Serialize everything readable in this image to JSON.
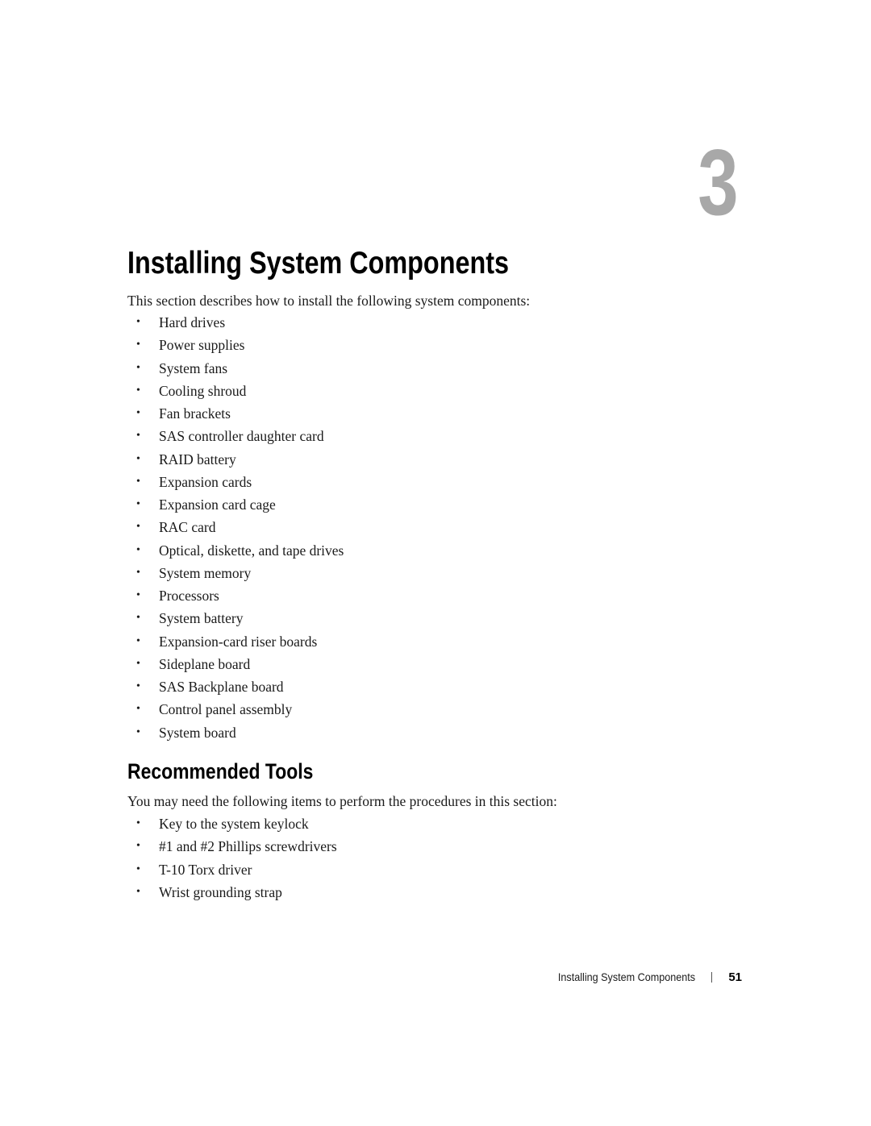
{
  "chapter": {
    "number": "3",
    "title": "Installing System Components"
  },
  "intro": "This section describes how to install the following system components:",
  "components": [
    "Hard drives",
    "Power supplies",
    "System fans",
    "Cooling shroud",
    "Fan brackets",
    "SAS controller daughter card",
    "RAID battery",
    "Expansion cards",
    "Expansion card cage",
    "RAC card",
    "Optical, diskette, and tape drives",
    "System memory",
    "Processors",
    "System battery",
    "Expansion-card riser boards",
    "Sideplane board",
    "SAS Backplane board",
    "Control panel assembly",
    "System board"
  ],
  "recommended_tools": {
    "title": "Recommended Tools",
    "intro": "You may need the following items to perform the procedures in this section:",
    "items": [
      "Key to the system keylock",
      "#1 and #2 Phillips screwdrivers",
      "T-10 Torx driver",
      "Wrist grounding strap"
    ]
  },
  "footer": {
    "title": "Installing System Components",
    "page_number": "51"
  },
  "bullet_glyph": "•"
}
